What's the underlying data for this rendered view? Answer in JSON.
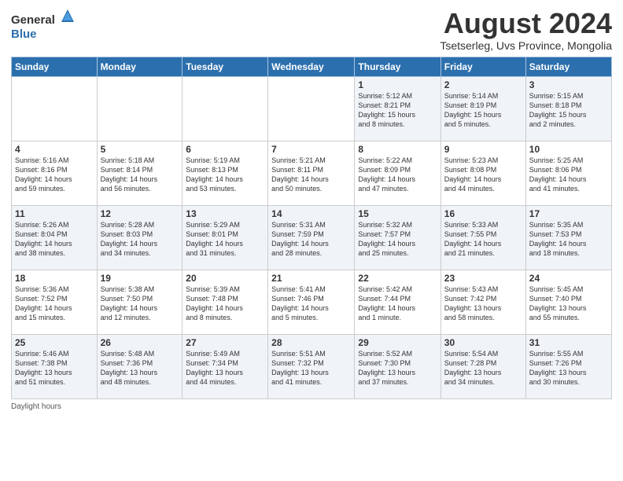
{
  "header": {
    "logo_general": "General",
    "logo_blue": "Blue",
    "month_title": "August 2024",
    "subtitle": "Tsetserleg, Uvs Province, Mongolia"
  },
  "weekdays": [
    "Sunday",
    "Monday",
    "Tuesday",
    "Wednesday",
    "Thursday",
    "Friday",
    "Saturday"
  ],
  "footer": {
    "label": "Daylight hours"
  },
  "weeks": [
    [
      {
        "day": "",
        "info": ""
      },
      {
        "day": "",
        "info": ""
      },
      {
        "day": "",
        "info": ""
      },
      {
        "day": "",
        "info": ""
      },
      {
        "day": "1",
        "info": "Sunrise: 5:12 AM\nSunset: 8:21 PM\nDaylight: 15 hours\nand 8 minutes."
      },
      {
        "day": "2",
        "info": "Sunrise: 5:14 AM\nSunset: 8:19 PM\nDaylight: 15 hours\nand 5 minutes."
      },
      {
        "day": "3",
        "info": "Sunrise: 5:15 AM\nSunset: 8:18 PM\nDaylight: 15 hours\nand 2 minutes."
      }
    ],
    [
      {
        "day": "4",
        "info": "Sunrise: 5:16 AM\nSunset: 8:16 PM\nDaylight: 14 hours\nand 59 minutes."
      },
      {
        "day": "5",
        "info": "Sunrise: 5:18 AM\nSunset: 8:14 PM\nDaylight: 14 hours\nand 56 minutes."
      },
      {
        "day": "6",
        "info": "Sunrise: 5:19 AM\nSunset: 8:13 PM\nDaylight: 14 hours\nand 53 minutes."
      },
      {
        "day": "7",
        "info": "Sunrise: 5:21 AM\nSunset: 8:11 PM\nDaylight: 14 hours\nand 50 minutes."
      },
      {
        "day": "8",
        "info": "Sunrise: 5:22 AM\nSunset: 8:09 PM\nDaylight: 14 hours\nand 47 minutes."
      },
      {
        "day": "9",
        "info": "Sunrise: 5:23 AM\nSunset: 8:08 PM\nDaylight: 14 hours\nand 44 minutes."
      },
      {
        "day": "10",
        "info": "Sunrise: 5:25 AM\nSunset: 8:06 PM\nDaylight: 14 hours\nand 41 minutes."
      }
    ],
    [
      {
        "day": "11",
        "info": "Sunrise: 5:26 AM\nSunset: 8:04 PM\nDaylight: 14 hours\nand 38 minutes."
      },
      {
        "day": "12",
        "info": "Sunrise: 5:28 AM\nSunset: 8:03 PM\nDaylight: 14 hours\nand 34 minutes."
      },
      {
        "day": "13",
        "info": "Sunrise: 5:29 AM\nSunset: 8:01 PM\nDaylight: 14 hours\nand 31 minutes."
      },
      {
        "day": "14",
        "info": "Sunrise: 5:31 AM\nSunset: 7:59 PM\nDaylight: 14 hours\nand 28 minutes."
      },
      {
        "day": "15",
        "info": "Sunrise: 5:32 AM\nSunset: 7:57 PM\nDaylight: 14 hours\nand 25 minutes."
      },
      {
        "day": "16",
        "info": "Sunrise: 5:33 AM\nSunset: 7:55 PM\nDaylight: 14 hours\nand 21 minutes."
      },
      {
        "day": "17",
        "info": "Sunrise: 5:35 AM\nSunset: 7:53 PM\nDaylight: 14 hours\nand 18 minutes."
      }
    ],
    [
      {
        "day": "18",
        "info": "Sunrise: 5:36 AM\nSunset: 7:52 PM\nDaylight: 14 hours\nand 15 minutes."
      },
      {
        "day": "19",
        "info": "Sunrise: 5:38 AM\nSunset: 7:50 PM\nDaylight: 14 hours\nand 12 minutes."
      },
      {
        "day": "20",
        "info": "Sunrise: 5:39 AM\nSunset: 7:48 PM\nDaylight: 14 hours\nand 8 minutes."
      },
      {
        "day": "21",
        "info": "Sunrise: 5:41 AM\nSunset: 7:46 PM\nDaylight: 14 hours\nand 5 minutes."
      },
      {
        "day": "22",
        "info": "Sunrise: 5:42 AM\nSunset: 7:44 PM\nDaylight: 14 hours\nand 1 minute."
      },
      {
        "day": "23",
        "info": "Sunrise: 5:43 AM\nSunset: 7:42 PM\nDaylight: 13 hours\nand 58 minutes."
      },
      {
        "day": "24",
        "info": "Sunrise: 5:45 AM\nSunset: 7:40 PM\nDaylight: 13 hours\nand 55 minutes."
      }
    ],
    [
      {
        "day": "25",
        "info": "Sunrise: 5:46 AM\nSunset: 7:38 PM\nDaylight: 13 hours\nand 51 minutes."
      },
      {
        "day": "26",
        "info": "Sunrise: 5:48 AM\nSunset: 7:36 PM\nDaylight: 13 hours\nand 48 minutes."
      },
      {
        "day": "27",
        "info": "Sunrise: 5:49 AM\nSunset: 7:34 PM\nDaylight: 13 hours\nand 44 minutes."
      },
      {
        "day": "28",
        "info": "Sunrise: 5:51 AM\nSunset: 7:32 PM\nDaylight: 13 hours\nand 41 minutes."
      },
      {
        "day": "29",
        "info": "Sunrise: 5:52 AM\nSunset: 7:30 PM\nDaylight: 13 hours\nand 37 minutes."
      },
      {
        "day": "30",
        "info": "Sunrise: 5:54 AM\nSunset: 7:28 PM\nDaylight: 13 hours\nand 34 minutes."
      },
      {
        "day": "31",
        "info": "Sunrise: 5:55 AM\nSunset: 7:26 PM\nDaylight: 13 hours\nand 30 minutes."
      }
    ]
  ]
}
